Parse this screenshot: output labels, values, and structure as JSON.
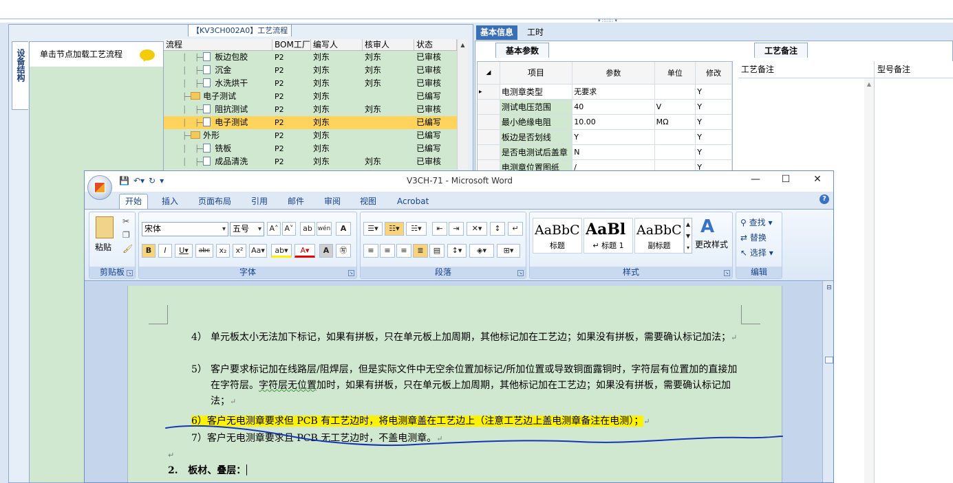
{
  "background_app": {
    "left_title": "【KV3CH002A0】工艺流程",
    "vertical_tab": "设备结构",
    "node_hint": "单击节点加载工艺流程",
    "grid": {
      "columns": [
        "流程",
        "BOM工厂",
        "编写人",
        "核审人",
        "状态"
      ],
      "rows": [
        {
          "name": "板边包胶",
          "type": "doc",
          "factory": "P2",
          "writer": "刘东",
          "reviewer": "刘东",
          "status": "已审核"
        },
        {
          "name": "沉金",
          "type": "doc",
          "factory": "P2",
          "writer": "刘东",
          "reviewer": "刘东",
          "status": "已审核"
        },
        {
          "name": "水洗烘干",
          "type": "doc",
          "factory": "P2",
          "writer": "刘东",
          "reviewer": "刘东",
          "status": "已审核"
        },
        {
          "name": "电子测试",
          "type": "folder",
          "factory": "P2",
          "writer": "刘东",
          "reviewer": "",
          "status": "已编写"
        },
        {
          "name": "阻抗测试",
          "type": "doc",
          "factory": "P2",
          "writer": "刘东",
          "reviewer": "刘东",
          "status": "已审核"
        },
        {
          "name": "电子测试",
          "type": "doc",
          "factory": "P2",
          "writer": "刘东",
          "reviewer": "",
          "status": "已编写",
          "selected": true
        },
        {
          "name": "外形",
          "type": "folder",
          "factory": "P2",
          "writer": "刘东",
          "reviewer": "",
          "status": "已编写"
        },
        {
          "name": "铣板",
          "type": "doc",
          "factory": "P2",
          "writer": "刘东",
          "reviewer": "",
          "status": "已编写"
        },
        {
          "name": "成品清洗",
          "type": "doc",
          "factory": "P2",
          "writer": "刘东",
          "reviewer": "刘东",
          "status": "已审核"
        }
      ]
    },
    "right_tabs": [
      "基本信息",
      "工时"
    ],
    "sub_tab_params": "基本参数",
    "sub_tab_remark": "工艺备注",
    "param_grid": {
      "columns": [
        "项目",
        "参数",
        "单位",
        "修改"
      ],
      "rows": [
        {
          "item": "电测章类型",
          "param": "无要求",
          "unit": "",
          "edit": "Y"
        },
        {
          "item": "测试电压范围",
          "param": "40",
          "unit": "V",
          "edit": "Y"
        },
        {
          "item": "最小绝缘电阻",
          "param": "10.00",
          "unit": "MΩ",
          "edit": "Y"
        },
        {
          "item": "板边是否划线",
          "param": "Y",
          "unit": "",
          "edit": "Y"
        },
        {
          "item": "是否电测试后盖章",
          "param": "N",
          "unit": "",
          "edit": "Y"
        },
        {
          "item": "电测章位置图纸",
          "param": "/",
          "unit": "",
          "edit": "Y"
        }
      ]
    },
    "remark_cols": [
      "工艺备注",
      "型号备注"
    ]
  },
  "word": {
    "title": "V3CH-71 - Microsoft Word",
    "tabs": [
      "开始",
      "插入",
      "页面布局",
      "引用",
      "邮件",
      "审阅",
      "视图",
      "Acrobat"
    ],
    "active_tab": "开始",
    "groups": {
      "clipboard": "剪贴板",
      "font": "字体",
      "paragraph": "段落",
      "styles": "样式",
      "editing": "编辑"
    },
    "paste_label": "粘贴",
    "font_name": "宋体",
    "font_size": "五号",
    "styles": [
      {
        "sample": "AaBbC",
        "caption": "标题"
      },
      {
        "sample": "AaBl",
        "caption": "↵ 标题 1"
      },
      {
        "sample": "AaBbC",
        "caption": "副标题"
      }
    ],
    "change_styles": "更改样式",
    "editing": {
      "find": "查找",
      "replace": "替换",
      "select": "选择"
    },
    "doc": {
      "p4_num": "4）",
      "p4_text": "单元板太小无法加下标记，如果有拼板，只在单元板上加周期，其他标记加在工艺边；如果没有拼板，需要确认标记加法；",
      "p5_num": "5）",
      "p5_text_a": "客户要求标记加在线路层/阻焊层，但是实际文件中无空余位置加标记/所加位置或导致铜面露铜时，字符层有位置加的直接加在字符层。",
      "p5_text_b": "字符层无位置",
      "p5_text_c": "加时，如果有拼板，只在单元板上加周期，其他标记加在工艺边；如果没有拼板，需要确认标记加法；",
      "p6_num": "6）",
      "p6_text": "客户无电测章要求但 PCB 有工艺边时，将电测章盖在工艺边上（注意工艺边上盖电测章备注在电测）；",
      "p7_num": "7）",
      "p7_text": "客户无电测章要求且 PCB 无工艺边时，不盖电测章。",
      "heading_num": "2.",
      "heading_text": "板材、叠层："
    }
  }
}
